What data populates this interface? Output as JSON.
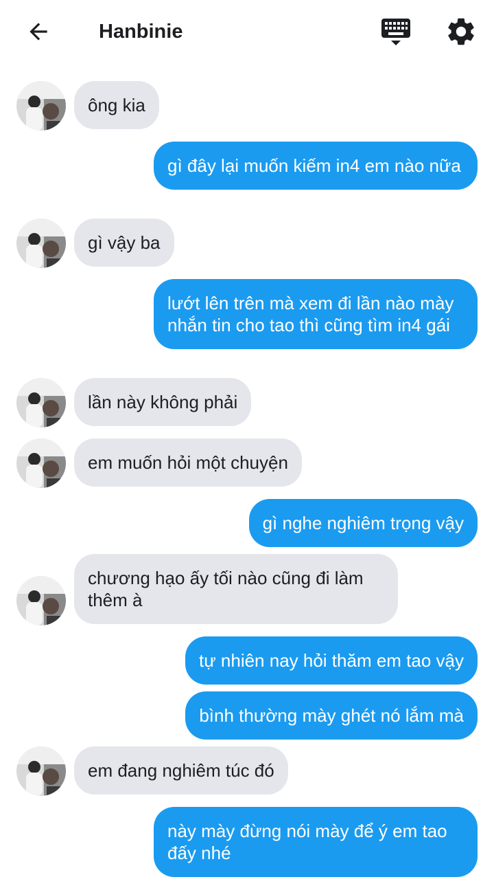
{
  "header": {
    "title": "Hanbinie",
    "back_icon": "arrow-left-icon",
    "keyboard_icon": "keyboard-icon",
    "settings_icon": "gear-icon"
  },
  "colors": {
    "outgoing_bubble": "#1a9bf0",
    "incoming_bubble": "#e4e6eb"
  },
  "messages": [
    {
      "from": "other",
      "text": "ông kia"
    },
    {
      "from": "me",
      "text": "gì đây lại muốn kiếm in4 em nào nữa"
    },
    {
      "from": "other",
      "text": "gì vậy ba"
    },
    {
      "from": "me",
      "text": "lướt lên trên mà xem đi lần nào mày nhắn tin cho tao thì cũng tìm in4 gái"
    },
    {
      "from": "other",
      "text": "lần này không phải"
    },
    {
      "from": "other",
      "text": "em muốn hỏi một chuyện"
    },
    {
      "from": "me",
      "text": "gì nghe nghiêm trọng vậy"
    },
    {
      "from": "other",
      "text": "chương hạo ấy tối nào cũng đi làm thêm à"
    },
    {
      "from": "me",
      "text": "tự nhiên nay hỏi thăm em tao vậy"
    },
    {
      "from": "me",
      "text": "bình thường mày ghét nó lắm mà"
    },
    {
      "from": "other",
      "text": "em đang nghiêm túc đó"
    },
    {
      "from": "me",
      "text": "này mày đừng nói mày để ý em tao đấy nhé"
    }
  ]
}
